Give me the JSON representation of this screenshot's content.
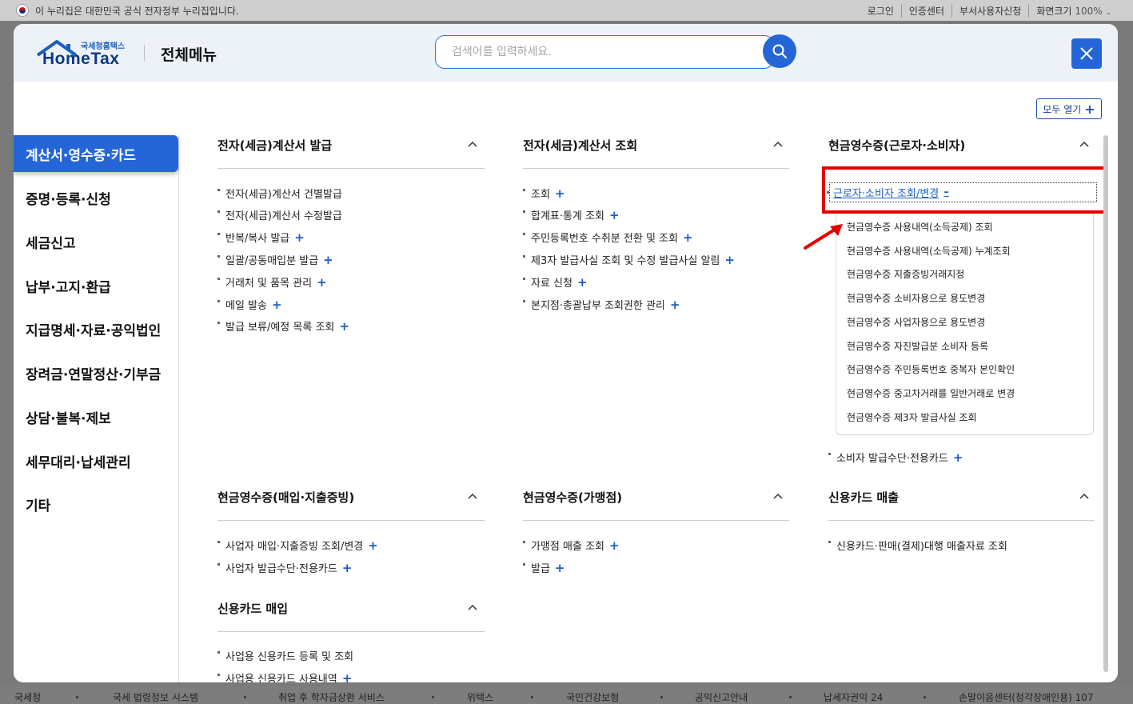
{
  "gov_bar": {
    "notice": "이 누리집은 대한민국 공식 전자정부 누리집입니다.",
    "login": "로그인",
    "cert_center": "인증센터",
    "dept_user": "부서사용자신청",
    "zoom_label": "화면크기",
    "zoom_value": "100%"
  },
  "header": {
    "logo_small": "국세청홈택스",
    "logo_big": "HomeTax",
    "title": "전체메뉴",
    "search_placeholder": "검색어를 입력하세요."
  },
  "expand_all": "모두 열기",
  "sidebar": [
    "계산서·영수증·카드",
    "증명·등록·신청",
    "세금신고",
    "납부·고지·환급",
    "지급명세·자료·공익법인",
    "장려금·연말정산·기부금",
    "상담·불복·제보",
    "세무대리·납세관리",
    "기타"
  ],
  "sections": {
    "s1": {
      "title": "전자(세금)계산서 발급",
      "items": [
        {
          "label": "전자(세금)계산서 건별발급",
          "plus": false
        },
        {
          "label": "전자(세금)계산서 수정발급",
          "plus": false
        },
        {
          "label": "반복/복사 발급",
          "plus": true
        },
        {
          "label": "일괄/공동매입분 발급",
          "plus": true
        },
        {
          "label": "거래처 및 품목 관리",
          "plus": true
        },
        {
          "label": "메일 발송",
          "plus": true
        },
        {
          "label": "발급 보류/예정 목록 조회",
          "plus": true
        }
      ]
    },
    "s2": {
      "title": "전자(세금)계산서 조회",
      "items": [
        {
          "label": "조회",
          "plus": true
        },
        {
          "label": "합계표·통계 조회",
          "plus": true
        },
        {
          "label": "주민등록번호 수취분 전환 및 조회",
          "plus": true
        },
        {
          "label": "제3자 발급사실 조회 및 수정 발급사실 알림",
          "plus": true
        },
        {
          "label": "자료 신청",
          "plus": true
        },
        {
          "label": "본지점·총괄납부 조회권한 관리",
          "plus": true
        }
      ]
    },
    "s3": {
      "title": "현금영수증(근로자·소비자)",
      "selected": "근로자·소비자 조회/변경",
      "sub_items": [
        "현금영수증 사용내역(소득공제) 조회",
        "현금영수증 사용내역(소득공제) 누계조회",
        "현금영수증 지출증빙거래지정",
        "현금영수증 소비자용으로 용도변경",
        "현금영수증 사업자용으로 용도변경",
        "현금영수증 자진발급분 소비자 등록",
        "현금영수증 주민등록번호 중복자 본인확인",
        "현금영수증 중고차거래를 일반거래로 변경",
        "현금영수증 제3자 발급사실 조회"
      ],
      "after": {
        "label": "소비자 발급수단·전용카드",
        "plus": true
      }
    },
    "s4": {
      "title": "현금영수증(매입·지출증빙)",
      "items": [
        {
          "label": "사업자 매입·지출증빙 조회/변경",
          "plus": true
        },
        {
          "label": "사업자 발급수단·전용카드",
          "plus": true
        }
      ]
    },
    "s5": {
      "title": "현금영수증(가맹점)",
      "items": [
        {
          "label": "가맹점 매출 조회",
          "plus": true
        },
        {
          "label": "발급",
          "plus": true
        }
      ]
    },
    "s6": {
      "title": "신용카드 매출",
      "items": [
        {
          "label": "신용카드·판매(결제)대행 매출자료 조회",
          "plus": false
        }
      ]
    },
    "s7": {
      "title": "신용카드 매입",
      "items": [
        {
          "label": "사업용 신용카드 등록 및 조회",
          "plus": false
        },
        {
          "label": "사업용 신용카드 사용내역",
          "plus": true
        }
      ]
    }
  },
  "footer": [
    "국세청",
    "국세 법령정보 시스템",
    "취업 후 학자금상환 서비스",
    "위택스",
    "국민건강보험",
    "공익신고안내",
    "납세자권익 24",
    "손말이음센터(청각장애인용) 107"
  ],
  "colors": {
    "accent": "#2466d8",
    "highlight": "#e50000"
  }
}
